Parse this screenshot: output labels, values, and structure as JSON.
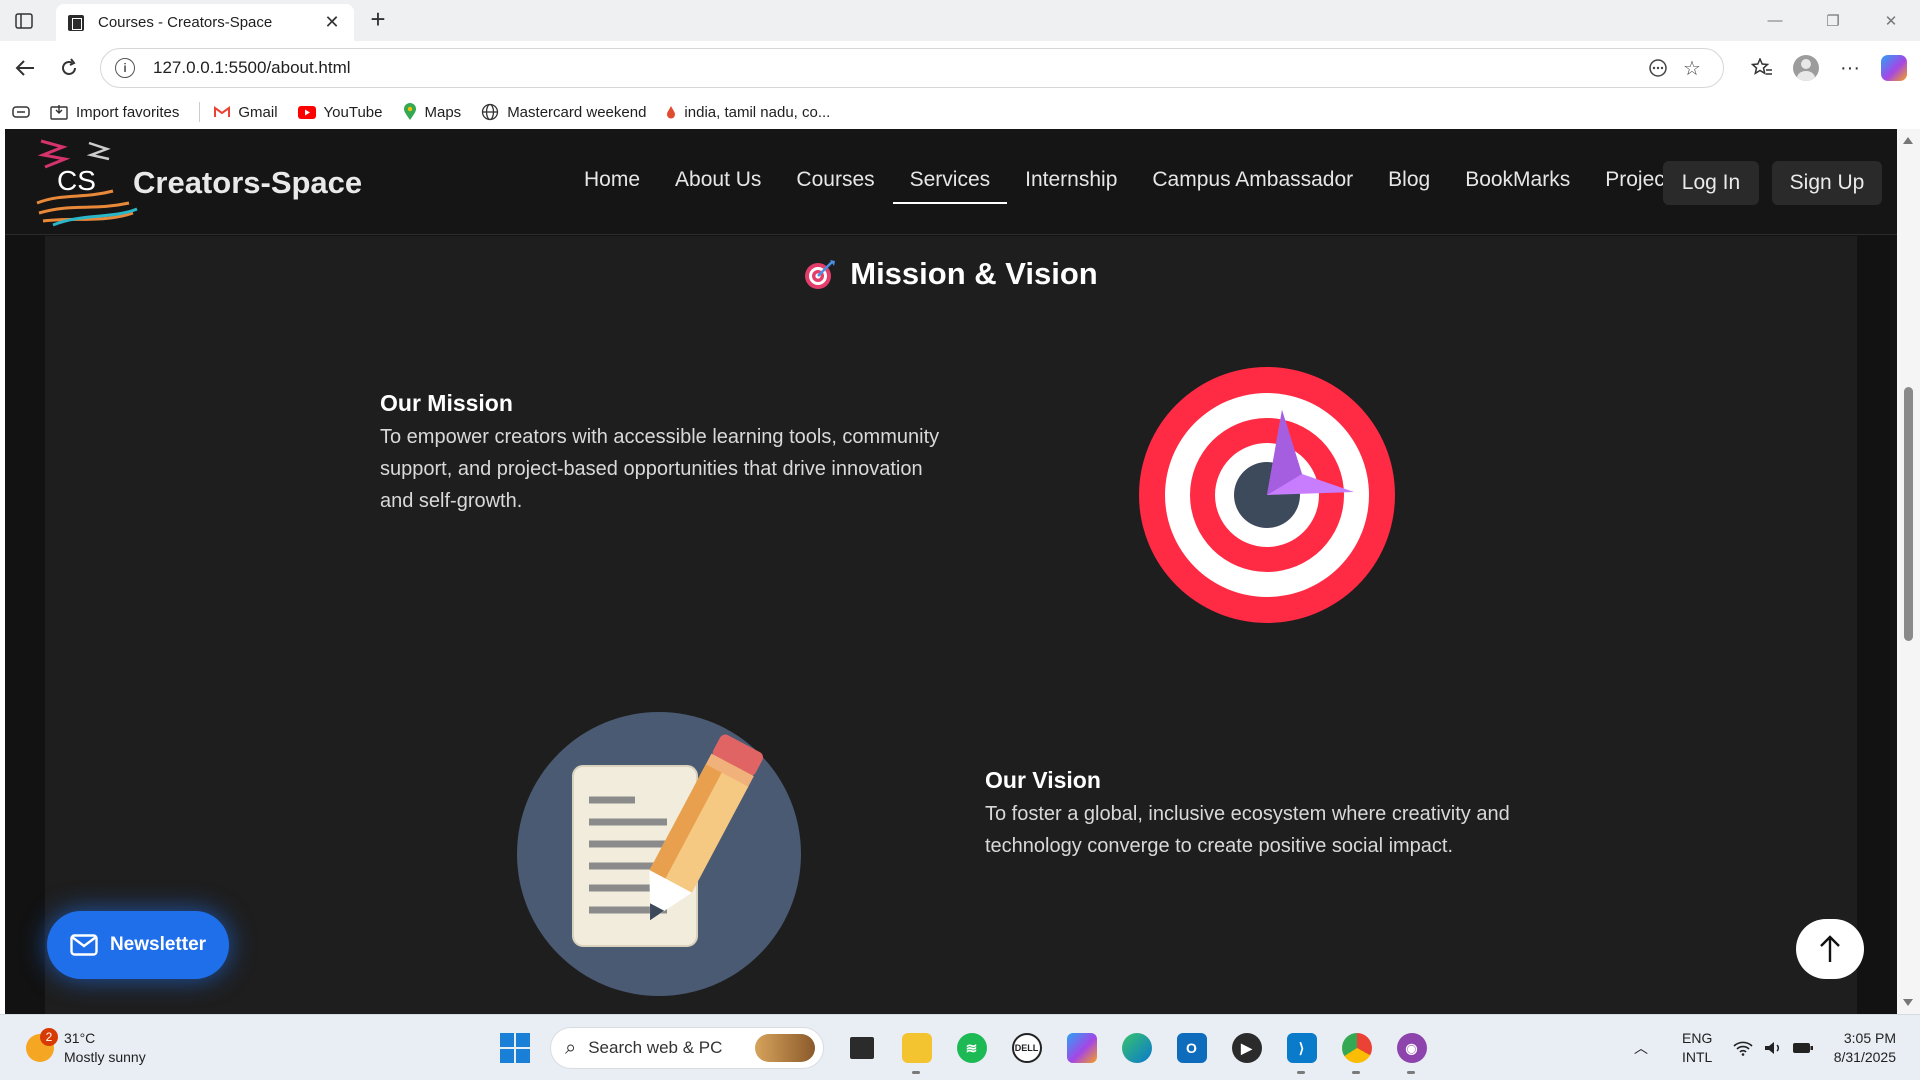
{
  "browser": {
    "tab": {
      "title": "Courses - Creators-Space"
    },
    "url": "127.0.0.1:5500/about.html",
    "favorites": [
      {
        "label": "Import favorites",
        "icon": "import-icon"
      },
      {
        "label": "Gmail",
        "icon": "gmail-icon"
      },
      {
        "label": "YouTube",
        "icon": "youtube-icon"
      },
      {
        "label": "Maps",
        "icon": "maps-icon"
      },
      {
        "label": "Mastercard weekend",
        "icon": "globe-icon"
      },
      {
        "label": "india, tamil nadu, co...",
        "icon": "drop-icon"
      }
    ]
  },
  "site": {
    "logo_text": "CS",
    "brand": "Creators-Space",
    "menu": [
      {
        "label": "Home",
        "active": false
      },
      {
        "label": "About Us",
        "active": false
      },
      {
        "label": "Courses",
        "active": false
      },
      {
        "label": "Services",
        "active": true
      },
      {
        "label": "Internship",
        "active": false
      },
      {
        "label": "Campus Ambassador",
        "active": false
      },
      {
        "label": "Blog",
        "active": false
      },
      {
        "label": "BookMarks",
        "active": false
      },
      {
        "label": "Projects",
        "active": false
      }
    ],
    "login_label": "Log In",
    "signup_label": "Sign Up"
  },
  "section": {
    "title": "Mission & Vision",
    "mission": {
      "title": "Our Mission",
      "text_lines": [
        "To empower creators with accessible learning tools, community",
        "support, and project-based opportunities that drive innovation",
        "and self-growth."
      ]
    },
    "vision": {
      "title": "Our Vision",
      "text_lines": [
        "To foster a global, inclusive ecosystem where creativity and",
        "technology converge to create positive social impact."
      ]
    }
  },
  "floating": {
    "newsletter_label": "Newsletter"
  },
  "taskbar": {
    "weather": {
      "temp": "31°C",
      "desc": "Mostly sunny",
      "badge": "2"
    },
    "search_placeholder": "Search web & PC",
    "lang_top": "ENG",
    "lang_bottom": "INTL",
    "time": "3:05 PM",
    "date": "8/31/2025"
  },
  "colors": {
    "page_bg": "#121212",
    "section_bg": "#1e1e1e",
    "newsletter": "#1f6feb",
    "target_red": "#ff2a44",
    "arrow_purple": "#c87dff"
  }
}
